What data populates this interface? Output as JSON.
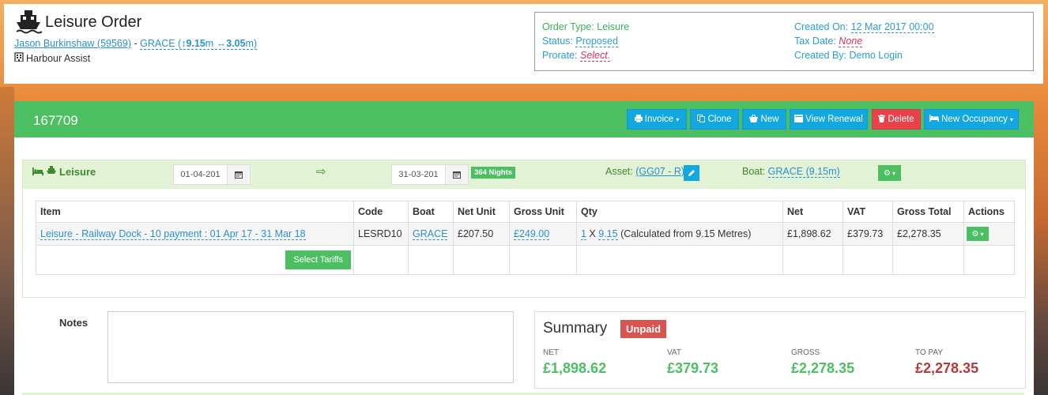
{
  "header": {
    "title": "Leisure Order",
    "customer_link": "Jason Burkinshaw (59569)",
    "sep": " - ",
    "boat_prefix": "GRACE (",
    "boat_length": "9.15",
    "boat_beam": "3.05",
    "unit": "m",
    "close": ")",
    "harbour": "Harbour Assist"
  },
  "info": {
    "order_type_label": "Order Type: Leisure",
    "status_label": "Status:",
    "status_value": "Proposed",
    "prorate_label": "Prorate:",
    "prorate_value": "Select.",
    "created_on_label": "Created On:",
    "created_on_value": "12 Mar 2017 00:00",
    "tax_date_label": "Tax Date:",
    "tax_date_value": "None",
    "created_by_label": "Created By: Demo Login"
  },
  "order": {
    "number": "167709",
    "buttons": {
      "invoice": "Invoice",
      "clone": "Clone",
      "new": "New",
      "view_renewal": "View Renewal",
      "delete": "Delete",
      "new_occupancy": "New Occupancy"
    }
  },
  "occupancy": {
    "label": "Leisure",
    "start_date": "01-04-201",
    "end_date": "31-03-201",
    "nights": "364 Nights",
    "asset_label": "Asset:",
    "asset_value": "(GG07 - R)",
    "boat_label": "Boat:",
    "boat_value": "GRACE (9.15m)"
  },
  "table": {
    "headers": [
      "Item",
      "Code",
      "Boat",
      "Net Unit",
      "Gross Unit",
      "Qty",
      "Net",
      "VAT",
      "Gross Total",
      "Actions"
    ],
    "row": {
      "item": "Leisure - Railway Dock - 10 payment : 01 Apr 17 - 31 Mar 18",
      "code": "LESRD10",
      "boat": "GRACE",
      "net_unit": "£207.50",
      "gross_unit": "£249.00",
      "qty_a": "1",
      "qty_x": " X ",
      "qty_b": "9.15",
      "qty_note": " (Calculated from 9.15 Metres)",
      "net": "£1,898.62",
      "vat": "£379.73",
      "gross_total": "£2,278.35"
    },
    "select_tariffs": "Select Tariffs"
  },
  "notes": {
    "label": "Notes"
  },
  "summary": {
    "title": "Summary",
    "status": "Unpaid",
    "net_label": "NET",
    "net_value": "£1,898.62",
    "vat_label": "VAT",
    "vat_value": "£379.73",
    "gross_label": "GROSS",
    "gross_value": "£2,278.35",
    "topay_label": "TO PAY",
    "topay_value": "£2,278.35"
  },
  "colors": {
    "accent_green": "#4cbf63",
    "button_blue": "#13a7e0",
    "danger_red": "#e8424a",
    "link_blue": "#2a8fd0"
  },
  "icons": [
    "ship-icon",
    "building-icon",
    "arrows-vertical-icon",
    "arrows-horizontal-icon",
    "print-icon",
    "copy-icon",
    "basket-icon",
    "book-icon",
    "trash-icon",
    "bed-icon",
    "calendar-icon",
    "arrow-right-icon",
    "pencil-icon",
    "gear-icon",
    "caret-down-icon"
  ]
}
